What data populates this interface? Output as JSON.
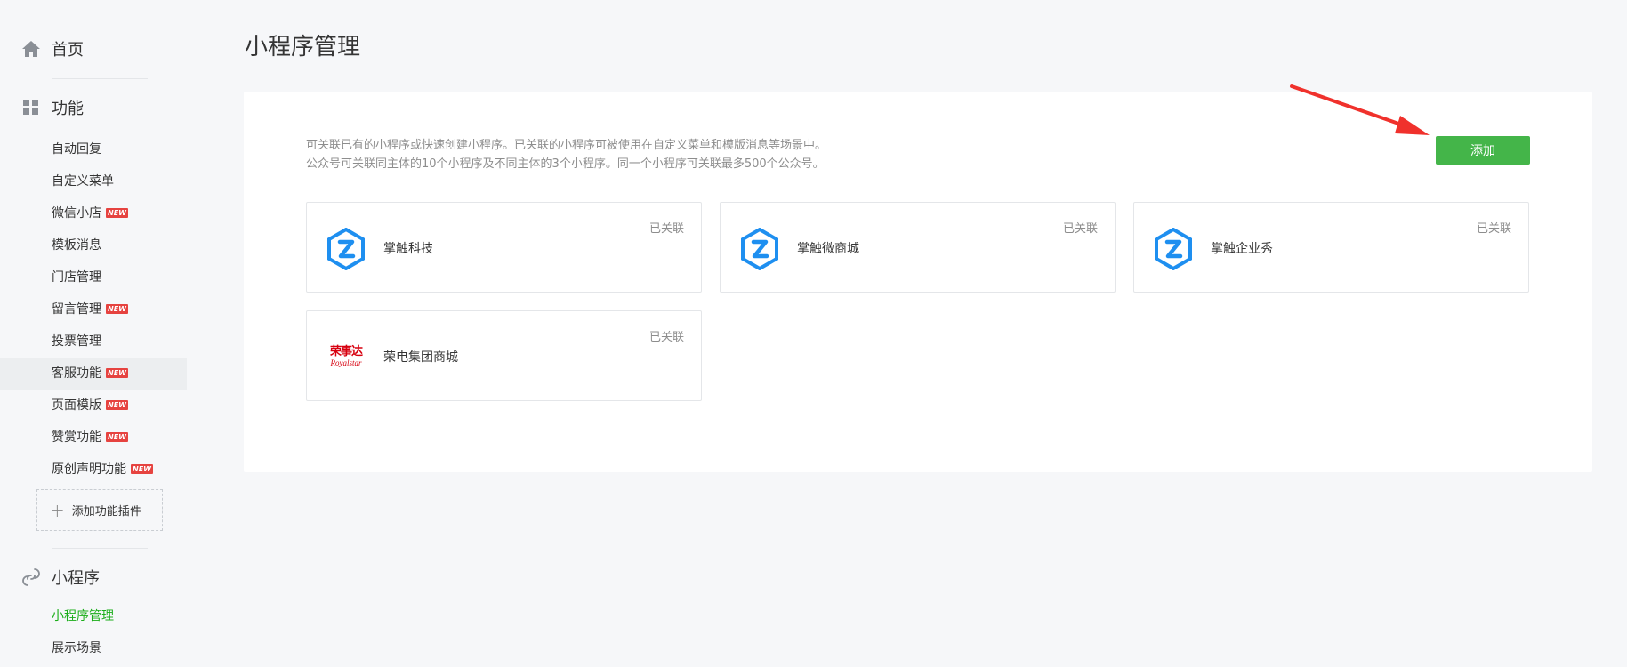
{
  "sidebar": {
    "home_label": "首页",
    "func_label": "功能",
    "func_items": [
      {
        "label": "自动回复",
        "new": false
      },
      {
        "label": "自定义菜单",
        "new": false
      },
      {
        "label": "微信小店",
        "new": true
      },
      {
        "label": "模板消息",
        "new": false
      },
      {
        "label": "门店管理",
        "new": false
      },
      {
        "label": "留言管理",
        "new": true
      },
      {
        "label": "投票管理",
        "new": false
      },
      {
        "label": "客服功能",
        "new": true
      },
      {
        "label": "页面模版",
        "new": true
      },
      {
        "label": "赞赏功能",
        "new": true
      },
      {
        "label": "原创声明功能",
        "new": true
      }
    ],
    "new_badge": "NEW",
    "add_plugin_label": "添加功能插件",
    "mini_label": "小程序",
    "mini_items": [
      {
        "label": "小程序管理",
        "active": true
      },
      {
        "label": "展示场景",
        "active": false
      }
    ]
  },
  "main": {
    "title": "小程序管理",
    "desc_line1": "可关联已有的小程序或快速创建小程序。已关联的小程序可被使用在自定义菜单和模版消息等场景中。",
    "desc_line2": "公众号可关联同主体的10个小程序及不同主体的3个小程序。同一个小程序可关联最多500个公众号。",
    "add_button": "添加",
    "cards": [
      {
        "name": "掌触科技",
        "status": "已关联",
        "logo": "zhangchu-logo"
      },
      {
        "name": "掌触微商城",
        "status": "已关联",
        "logo": "zhangchu-logo"
      },
      {
        "name": "掌触企业秀",
        "status": "已关联",
        "logo": "zhangchu-logo"
      },
      {
        "name": "荣电集团商城",
        "status": "已关联",
        "logo": "royalstar-logo",
        "logo_cn": "荣事达",
        "logo_en": "Royalstar"
      }
    ]
  },
  "colors": {
    "accent_green": "#44b549",
    "new_badge_red": "#e64340",
    "arrow_red": "#f0312c",
    "logo_blue": "#1e8ff0"
  }
}
